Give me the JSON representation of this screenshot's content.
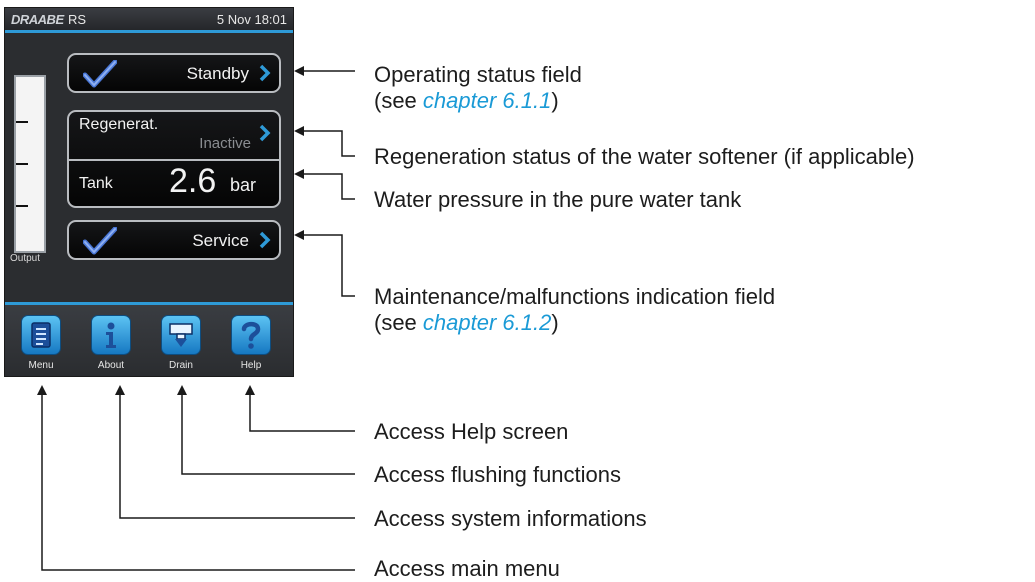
{
  "device": {
    "brand": "DRAABE",
    "model": "RS",
    "datetime": "5 Nov 18:01",
    "output_label": "Output",
    "status_field": {
      "value": "Standby"
    },
    "regeneration_field": {
      "label": "Regenerat.",
      "value": "Inactive"
    },
    "tank_field": {
      "label": "Tank",
      "value": "2.6",
      "unit": "bar"
    },
    "service_field": {
      "value": "Service"
    },
    "nav": [
      {
        "label": "Menu",
        "icon": "menu-document-icon"
      },
      {
        "label": "About",
        "icon": "info-icon"
      },
      {
        "label": "Drain",
        "icon": "drain-icon"
      },
      {
        "label": "Help",
        "icon": "help-icon"
      }
    ]
  },
  "callouts": {
    "operating_status": {
      "line1": "Operating status field",
      "line2_prefix": "(see ",
      "line2_link": "chapter 6.1.1",
      "line2_suffix": ")"
    },
    "regeneration_status": "Regeneration status of the water softener (if applicable)",
    "water_pressure": "Water pressure in the pure water tank",
    "maintenance": {
      "line1": "Maintenance/malfunctions indication field",
      "line2_prefix": "(see ",
      "line2_link": "chapter 6.1.2",
      "line2_suffix": ")"
    },
    "help_screen": "Access Help screen",
    "flushing": "Access flushing functions",
    "system_info": "Access system informations",
    "main_menu": "Access main menu"
  },
  "colors": {
    "accent_blue": "#2e9ad7",
    "screen_bg": "#2b2d30",
    "link": "#1a9ad6"
  }
}
